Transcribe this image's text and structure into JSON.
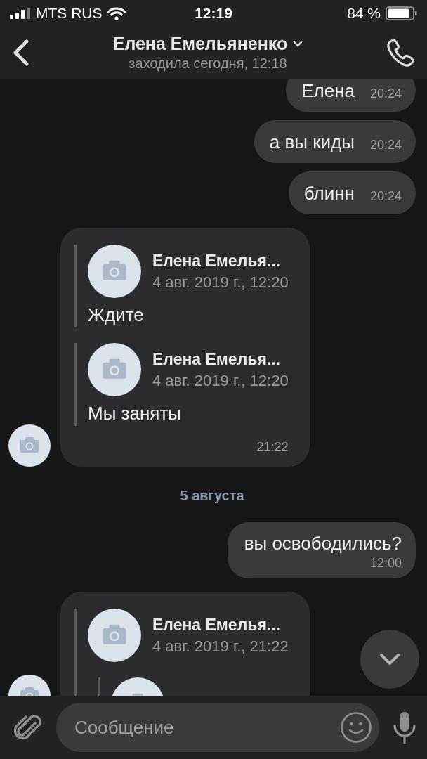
{
  "status_bar": {
    "carrier": "MTS RUS",
    "time": "12:19",
    "battery": "84 %"
  },
  "header": {
    "title": "Елена Емельяненко",
    "subtitle": "заходила сегодня, 12:18"
  },
  "messages": [
    {
      "kind": "outgoing",
      "text": "Елена",
      "time": "20:24",
      "time_below": false
    },
    {
      "kind": "outgoing",
      "text": "а вы киды",
      "time": "20:24",
      "time_below": false
    },
    {
      "kind": "outgoing",
      "text": "блинн",
      "time": "20:24",
      "time_below": false
    },
    {
      "kind": "forwarded",
      "time": "21:22",
      "quotes": [
        {
          "author": "Елена Емелья...",
          "date": "4 авг. 2019 г., 12:20",
          "text": "Ждите"
        },
        {
          "author": "Елена Емелья...",
          "date": "4 авг. 2019 г., 12:20",
          "text": "Мы заняты"
        }
      ]
    },
    {
      "kind": "date",
      "text": "5 августа"
    },
    {
      "kind": "outgoing",
      "text": "вы освободились?",
      "time": "12:00",
      "time_below": true
    },
    {
      "kind": "forwarded",
      "quotes": [
        {
          "author": "Елена Емелья...",
          "date": "4 авг. 2019 г., 21:22",
          "nested": true
        }
      ]
    }
  ],
  "composer": {
    "placeholder": "Сообщение"
  }
}
